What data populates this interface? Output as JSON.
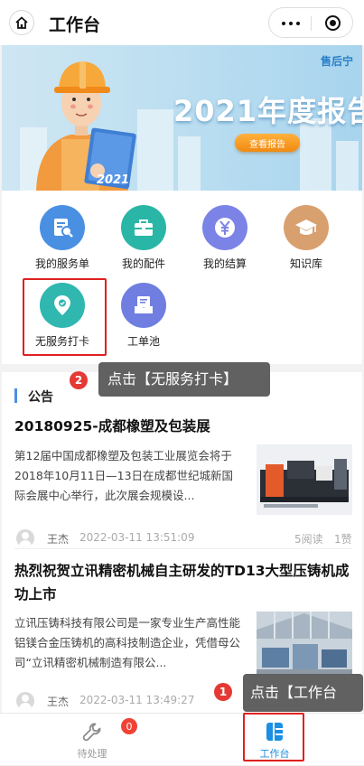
{
  "header": {
    "title": "工作台"
  },
  "banner": {
    "brand": "售后宁",
    "title": "2021年度报告",
    "button": "查看报告",
    "book_label": "2021"
  },
  "grid": {
    "items": [
      {
        "label": "我的服务单",
        "color": "#4a90e2",
        "icon": "service-order-icon"
      },
      {
        "label": "我的配件",
        "color": "#2ab6a6",
        "icon": "parts-toolbox-icon"
      },
      {
        "label": "我的结算",
        "color": "#7b83e6",
        "icon": "yen-coin-icon"
      },
      {
        "label": "知识库",
        "color": "#d9a06f",
        "icon": "graduation-cap-icon"
      },
      {
        "label": "无服务打卡",
        "color": "#2fb7b0",
        "icon": "location-pin-icon"
      },
      {
        "label": "工单池",
        "color": "#6f7ee0",
        "icon": "ticket-pool-icon"
      }
    ]
  },
  "notice": {
    "heading": "公告",
    "articles": [
      {
        "title": "20180925-成都橡塑及包装展",
        "summary": "第12届中国成都橡塑及包装工业展览会将于2018年10月11日—13日在成都世纪城新国际会展中心举行，此次展会规模设...",
        "author": "王杰",
        "time": "2022-03-11 13:51:09",
        "reads": "5阅读",
        "likes": "1赞"
      },
      {
        "title": "热烈祝贺立讯精密机械自主研发的TD13大型压铸机成功上市",
        "summary": "立讯压铸科技有限公司是一家专业生产高性能铝镁合金压铸机的高科技制造企业，凭借母公司“立讯精密机械制造有限公...",
        "author": "王杰",
        "time": "2022-03-11 13:49:27"
      }
    ]
  },
  "tips": [
    {
      "step": "2",
      "text": "点击【无服务打卡】"
    },
    {
      "step": "1",
      "text": "点击【工作台"
    }
  ],
  "tabbar": {
    "tabs": [
      {
        "label": "待处理",
        "badge": "0"
      },
      {
        "label": "工作台"
      }
    ]
  },
  "colors": {
    "accent": "#1a8fe3",
    "highlight": "#e02020"
  }
}
